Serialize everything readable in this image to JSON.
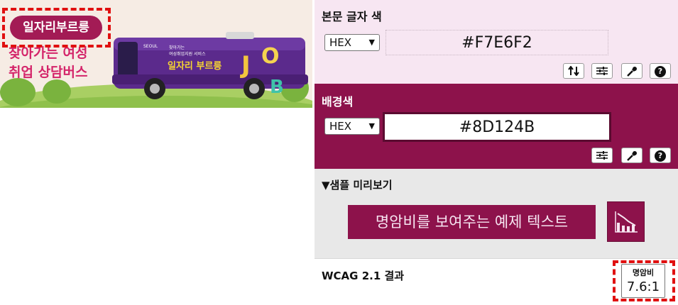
{
  "banner": {
    "badge": "일자리부르릉",
    "slogan_line1": "찾아가는 여성",
    "slogan_line2": "취업 상담버스",
    "bus_small_text1": "찾아가는",
    "bus_small_text2": "여성취업지원 서비스",
    "bus_brand": "일자리 부르릉",
    "bus_logo": "SEOUL",
    "job_letters": [
      "J",
      "O",
      "B"
    ]
  },
  "text_color": {
    "title": "본문 글자 색",
    "format": "HEX",
    "value": "#F7E6F2",
    "color": "#F7E6F2"
  },
  "background_color": {
    "title": "배경색",
    "format": "HEX",
    "value": "#8D124B",
    "color": "#8D124B"
  },
  "toolbar": {
    "swap_icon": "swap-vertical-icon",
    "sliders_icon": "sliders-icon",
    "eyedropper_icon": "eyedropper-icon",
    "help_label": "?"
  },
  "preview": {
    "title": "▼샘플 미리보기",
    "sample_text": "명암비를 보여주는 예제 텍스트",
    "graph_icon": "chart-icon"
  },
  "wcag": {
    "title": "WCAG 2.1 결과",
    "ratio_label": "명암비",
    "ratio_value": "7.6:1"
  }
}
